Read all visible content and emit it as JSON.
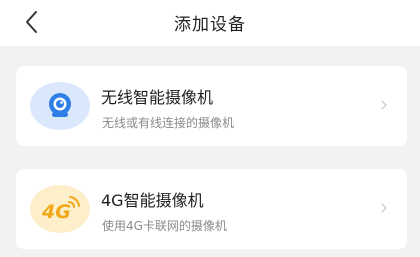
{
  "header": {
    "title": "添加设备",
    "back_icon": "chevron-left-icon"
  },
  "devices": [
    {
      "title": "无线智能摄像机",
      "subtitle": "无线或有线连接的摄像机",
      "icon": "wireless-camera-icon",
      "icon_bg": "#dbe8fb",
      "icon_color": "#2f7fe6"
    },
    {
      "title": "4G智能摄像机",
      "subtitle": "使用4G卡联网的摄像机",
      "icon": "4g-camera-icon",
      "icon_label": "4G",
      "icon_bg": "#fcefc9",
      "icon_color": "#f2a71b"
    }
  ],
  "colors": {
    "page_bg": "#f2f2f4",
    "card_bg": "#ffffff",
    "text_primary": "#1e1e1e",
    "text_secondary": "#8a8a8e"
  }
}
